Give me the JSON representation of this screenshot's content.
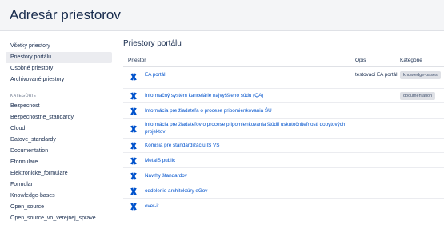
{
  "page": {
    "title": "Adresár priestorov"
  },
  "sidebar": {
    "items": [
      {
        "label": "Všetky priestory"
      },
      {
        "label": "Priestory portálu"
      },
      {
        "label": "Osobné priestory"
      },
      {
        "label": "Archivované priestory"
      }
    ],
    "categories_heading": "KATEGÓRIE",
    "categories": [
      {
        "label": "Bezpecnost"
      },
      {
        "label": "Bezpecnostne_standardy"
      },
      {
        "label": "Cloud"
      },
      {
        "label": "Datove_standardy"
      },
      {
        "label": "Documentation"
      },
      {
        "label": "Eformulare"
      },
      {
        "label": "Elektronicke_formulare"
      },
      {
        "label": "Formular"
      },
      {
        "label": "Knowledge-bases"
      },
      {
        "label": "Open_source"
      },
      {
        "label": "Open_source_vo_verejnej_sprave"
      }
    ]
  },
  "main": {
    "section_title": "Priestory portálu",
    "columns": {
      "space": "Priestor",
      "description": "Opis",
      "categories": "Kategórie"
    },
    "rows": [
      {
        "name": "EA portál",
        "description": "testovací EA portál",
        "category": "knowledge-bases"
      },
      {
        "name": "Informačný systém kancelárie najvyššieho súdu (QA)",
        "description": "",
        "category": "documentation"
      },
      {
        "name": "Informácia pre žiadateľa o procese pripomienkovania ŠU",
        "description": "",
        "category": ""
      },
      {
        "name": "Informácia pre žiadateľov o procese pripomienkovania štúdií uskutočniteľnosti dopytových projektov",
        "description": "",
        "category": ""
      },
      {
        "name": "Komisia pre štandardizáciu IS VS",
        "description": "",
        "category": ""
      },
      {
        "name": "MetaIS public",
        "description": "",
        "category": ""
      },
      {
        "name": "Návrhy štandardov",
        "description": "",
        "category": ""
      },
      {
        "name": "oddelenie architektúry eGov",
        "description": "",
        "category": ""
      },
      {
        "name": "over-it",
        "description": "",
        "category": ""
      }
    ]
  },
  "colors": {
    "link": "#0052cc",
    "icon": "#0052cc",
    "active_bg": "#ebecf0",
    "header_bg": "#f4f5f7"
  },
  "icons": {
    "space": "confluence-space-icon"
  }
}
